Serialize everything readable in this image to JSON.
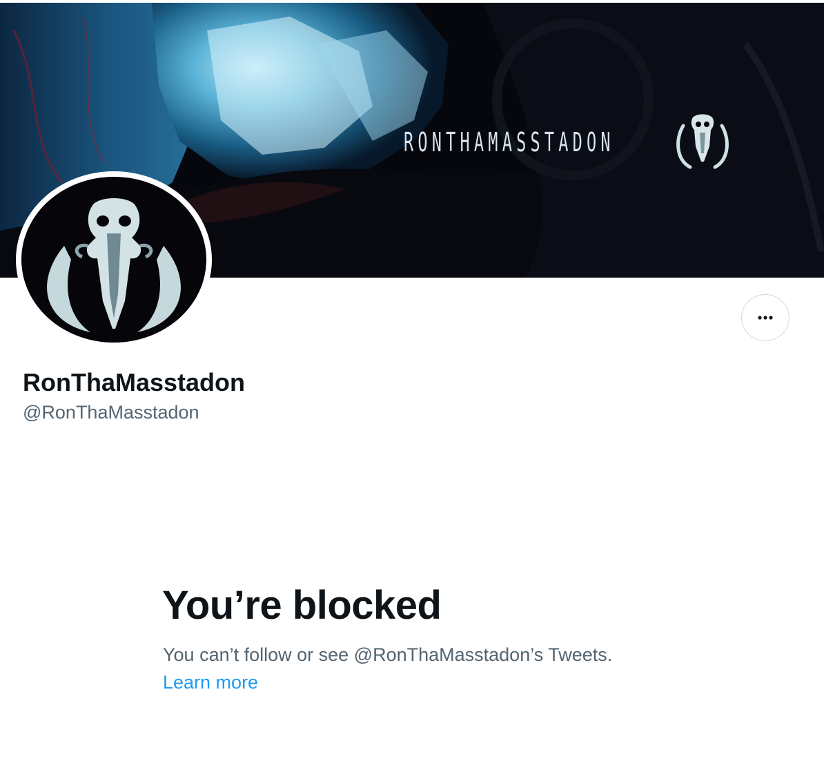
{
  "profile": {
    "banner_text": "RONTHAMASSTADON",
    "display_name": "RonThaMasstadon",
    "handle": "@RonThaMasstadon",
    "more_button_icon": "more-horizontal-icon"
  },
  "blocked": {
    "title": "You’re blocked",
    "description": "You can’t follow or see @RonThaMasstadon’s Tweets.",
    "learn_more_label": "Learn more"
  },
  "colors": {
    "primary_text": "#0f1419",
    "secondary_text": "#536471",
    "link": "#1d9bf0",
    "border": "#cfd9de"
  }
}
